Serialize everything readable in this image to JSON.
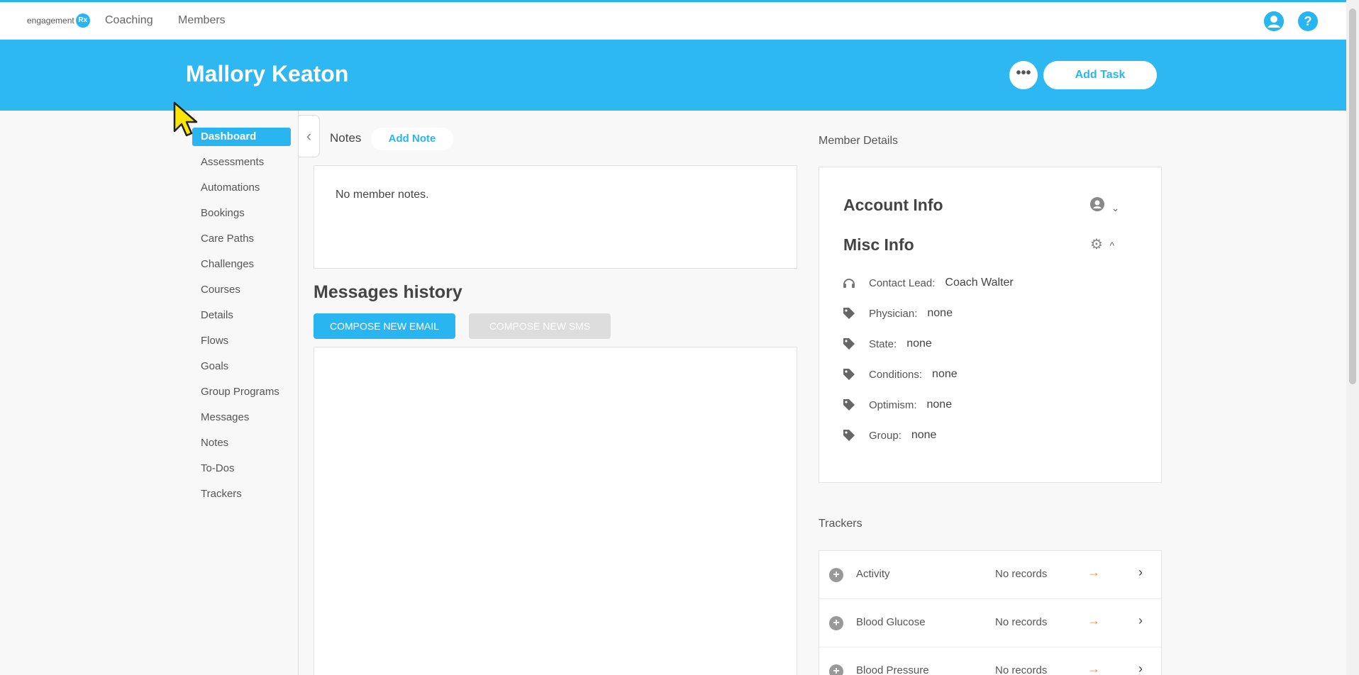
{
  "topbar": {
    "logo_text": "engagement",
    "logo_badge": "Rx",
    "nav": [
      "Coaching",
      "Members"
    ],
    "account_icon": "user-circle-icon",
    "help_icon": "question-icon"
  },
  "banner": {
    "member_name": "Mallory Keaton",
    "more_label": "•••",
    "add_task_label": "Add Task"
  },
  "sidebar": {
    "items": [
      {
        "label": "Dashboard",
        "active": true
      },
      {
        "label": "Assessments"
      },
      {
        "label": "Automations"
      },
      {
        "label": "Bookings"
      },
      {
        "label": "Care Paths"
      },
      {
        "label": "Challenges"
      },
      {
        "label": "Courses"
      },
      {
        "label": "Details"
      },
      {
        "label": "Flows"
      },
      {
        "label": "Goals"
      },
      {
        "label": "Group Programs"
      },
      {
        "label": "Messages"
      },
      {
        "label": "Notes"
      },
      {
        "label": "To-Dos"
      },
      {
        "label": "Trackers"
      }
    ]
  },
  "notes": {
    "title": "Notes",
    "add_note_label": "Add Note",
    "empty_text": "No member notes."
  },
  "messages": {
    "title": "Messages history",
    "compose_email_label": "COMPOSE NEW EMAIL",
    "compose_sms_label": "COMPOSE NEW SMS"
  },
  "member_details": {
    "title": "Member Details",
    "account_info_title": "Account Info",
    "misc_info_title": "Misc Info",
    "fields": [
      {
        "label": "Contact Lead:",
        "value": "Coach Walter",
        "icon": "headset-icon"
      },
      {
        "label": "Physician:",
        "value": "none",
        "icon": "tag-icon"
      },
      {
        "label": "State:",
        "value": "none",
        "icon": "tag-icon"
      },
      {
        "label": "Conditions:",
        "value": "none",
        "icon": "tag-icon"
      },
      {
        "label": "Optimism:",
        "value": "none",
        "icon": "tag-icon"
      },
      {
        "label": "Group:",
        "value": "none",
        "icon": "tag-icon"
      }
    ]
  },
  "trackers": {
    "title": "Trackers",
    "rows": [
      {
        "name": "Activity",
        "status": "No records",
        "arrow": "→"
      },
      {
        "name": "Blood Glucose",
        "status": "No records",
        "arrow": "→"
      },
      {
        "name": "Blood Pressure",
        "status": "No records",
        "arrow": "→"
      }
    ]
  },
  "colors": {
    "accent": "#29b6f0",
    "banner": "#2eb8f1",
    "arrow": "#f08a3c"
  }
}
